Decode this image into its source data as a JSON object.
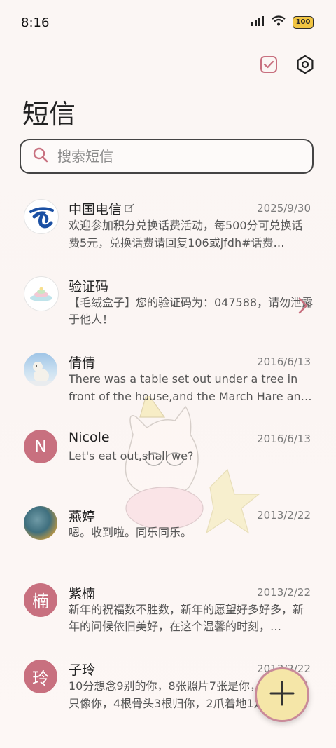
{
  "status_bar": {
    "time": "8:16",
    "battery": "100"
  },
  "header": {
    "title": "短信"
  },
  "search": {
    "placeholder": "搜索短信"
  },
  "conversations": [
    {
      "name": "中国电信",
      "date": "2025/9/30",
      "text": "欢迎参加积分兑换话费活动，每500分可兑换话费5元，兑换话费请回复106或jfdh#话费…"
    },
    {
      "name": "验证码",
      "date": "",
      "text": "【毛绒盒子】您的验证码为：047588，请勿泄露于他人！"
    },
    {
      "name": "倩倩",
      "date": "2016/6/13",
      "text": "There was a table set out under a tree in front of the house,and the March Hare an…"
    },
    {
      "name": "Nicole",
      "avatar_letter": "N",
      "date": "2016/6/13",
      "text": "Let's eat out,shall we?"
    },
    {
      "name": "燕婷",
      "date": "2013/2/22",
      "text": "嗯。收到啦。同乐同乐。"
    },
    {
      "name": "紫楠",
      "avatar_letter": "楠",
      "date": "2013/2/22",
      "text": "新年的祝福数不胜数，新年的愿望好多好多，新年的问候依旧美好，在这个温馨的时刻，…"
    },
    {
      "name": "子玲",
      "avatar_letter": "玲",
      "date": "2013/2/22",
      "text": "10分想念9别的你，8张照片7张是你，6只小狗5只像你，4根骨头3根归你，2爪着地1定…"
    }
  ],
  "colors": {
    "accent": "#c8707f",
    "avatar_pink": "#c8707f",
    "fab_fill": "#f5e6a8"
  },
  "icons": {
    "top_left": "checkbox-icon",
    "top_right": "settings-hexagon-icon",
    "fab": "plus-icon"
  }
}
